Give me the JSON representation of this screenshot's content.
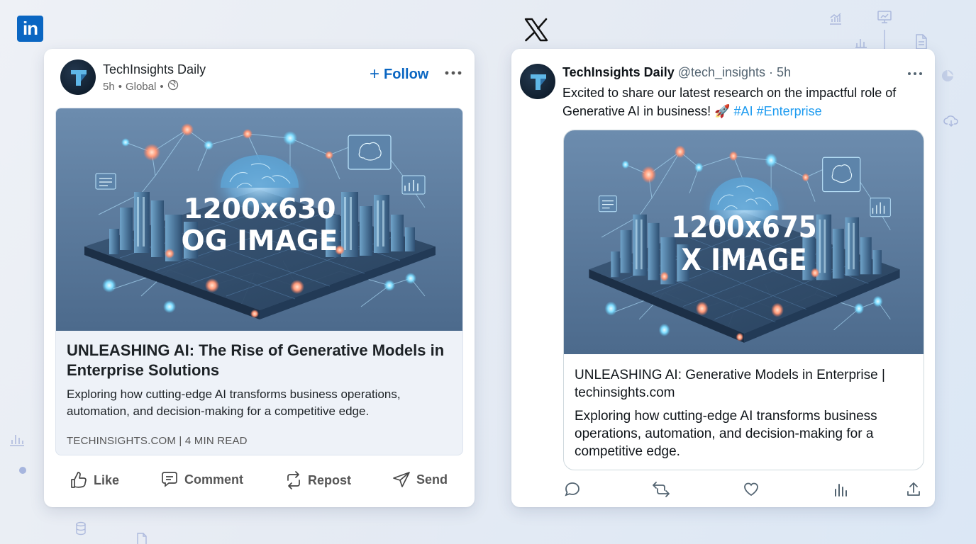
{
  "linkedin": {
    "logo_text": "in",
    "author": "TechInsights Daily",
    "time": "5h",
    "audience": "Global",
    "follow_label": "Follow",
    "image": {
      "line1": "1200x630",
      "line2": "OG IMAGE"
    },
    "preview_title": "UNLEASHING AI: The Rise of Generative Models in Enterprise Solutions",
    "preview_description": "Exploring how cutting-edge AI transforms business operations, automation, and decision-making for a competitive edge.",
    "preview_source": "TECHINSIGHTS.COM | 4 MIN READ",
    "actions": {
      "like": "Like",
      "comment": "Comment",
      "repost": "Repost",
      "send": "Send"
    }
  },
  "x": {
    "author": "TechInsights Daily",
    "handle_time": "@tech_insights · 5h",
    "text_main": "Excited to share our latest research on the impactful role of Generative AI in business! 🚀 ",
    "hashtags": "#AI #Enterprise",
    "image": {
      "line1": "1200x675",
      "line2": "X IMAGE"
    },
    "preview_title": "UNLEASHING AI: Generative Models in Enterprise | techinsights.com",
    "preview_description": "Exploring how cutting-edge AI transforms business operations, automation, and decision-making for a competitive edge."
  },
  "colors": {
    "linkedin_blue": "#0a66c2",
    "x_link_blue": "#1d9bf0",
    "card_bg": "#ffffff",
    "page_bg": "#e6ebf3"
  },
  "icons": {
    "linkedin_logo": "linkedin-logo-icon",
    "x_logo": "x-logo-icon",
    "globe": "globe-icon",
    "more": "more-horizontal-icon",
    "like": "thumbs-up-icon",
    "comment": "comment-icon",
    "repost": "repost-icon",
    "send": "send-icon",
    "reply": "reply-icon",
    "retweet": "retweet-icon",
    "heart": "heart-icon",
    "views": "bar-chart-icon",
    "share": "share-icon"
  }
}
